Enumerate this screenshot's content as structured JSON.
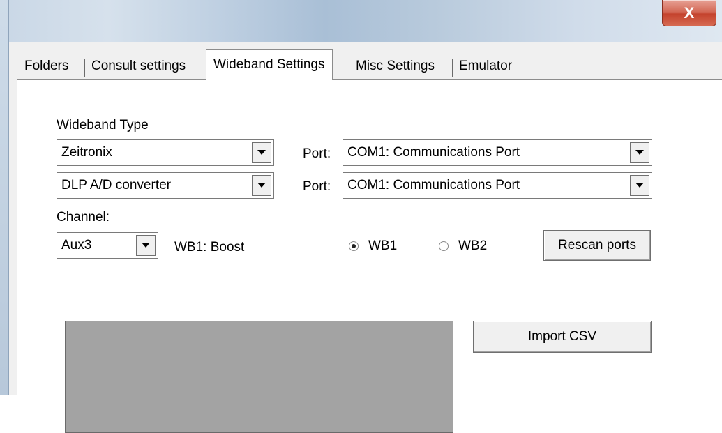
{
  "window": {
    "close_glyph": "X"
  },
  "tabs": [
    {
      "label": "Folders"
    },
    {
      "label": "Consult settings"
    },
    {
      "label": "Wideband Settings"
    },
    {
      "label": "Misc Settings"
    },
    {
      "label": "Emulator"
    }
  ],
  "wideband": {
    "type_label": "Wideband Type",
    "type_value": "Zeitronix",
    "converter_value": "DLP A/D converter",
    "port_label": "Port:",
    "port1_value": "COM1: Communications Port",
    "port2_value": "COM1: Communications Port",
    "channel_label": "Channel:",
    "channel_value": "Aux3",
    "wb1_status": "WB1: Boost",
    "radio_wb1": "WB1",
    "radio_wb2": "WB2",
    "selected_radio": "WB1",
    "rescan_button": "Rescan ports",
    "import_button": "Import CSV"
  },
  "icons": {
    "dropdown": "chevron-down-icon",
    "close": "close-icon"
  }
}
